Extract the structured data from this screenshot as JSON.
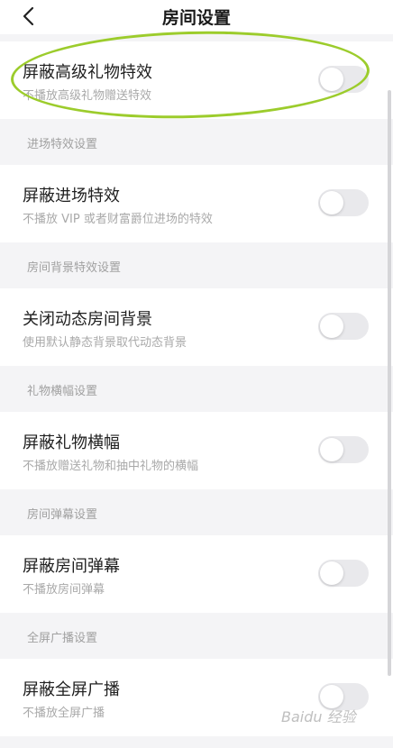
{
  "header": {
    "title": "房间设置",
    "back_icon": "chevron-left-icon"
  },
  "items": [
    {
      "title": "屏蔽高级礼物特效",
      "sub": "不播放高级礼物赠送特效",
      "toggle": "off"
    },
    {
      "section": "进场特效设置",
      "title": "屏蔽进场特效",
      "sub": "不播放 VIP 或者财富爵位进场的特效",
      "toggle": "off"
    },
    {
      "section": "房间背景特效设置",
      "title": "关闭动态房间背景",
      "sub": "使用默认静态背景取代动态背景",
      "toggle": "off"
    },
    {
      "section": "礼物横幅设置",
      "title": "屏蔽礼物横幅",
      "sub": "不播放赠送礼物和抽中礼物的横幅",
      "toggle": "off"
    },
    {
      "section": "房间弹幕设置",
      "title": "屏蔽房间弹幕",
      "sub": "不播放房间弹幕",
      "toggle": "off"
    },
    {
      "section": "全屏广播设置",
      "title": "屏蔽全屏广播",
      "sub": "不播放全屏广播",
      "toggle": "off"
    }
  ],
  "watermark": "Baidu 经验",
  "colors": {
    "highlight": "#9ccc2c",
    "toggle_off": "#e9e9ec",
    "background": "#f4f4f6"
  }
}
